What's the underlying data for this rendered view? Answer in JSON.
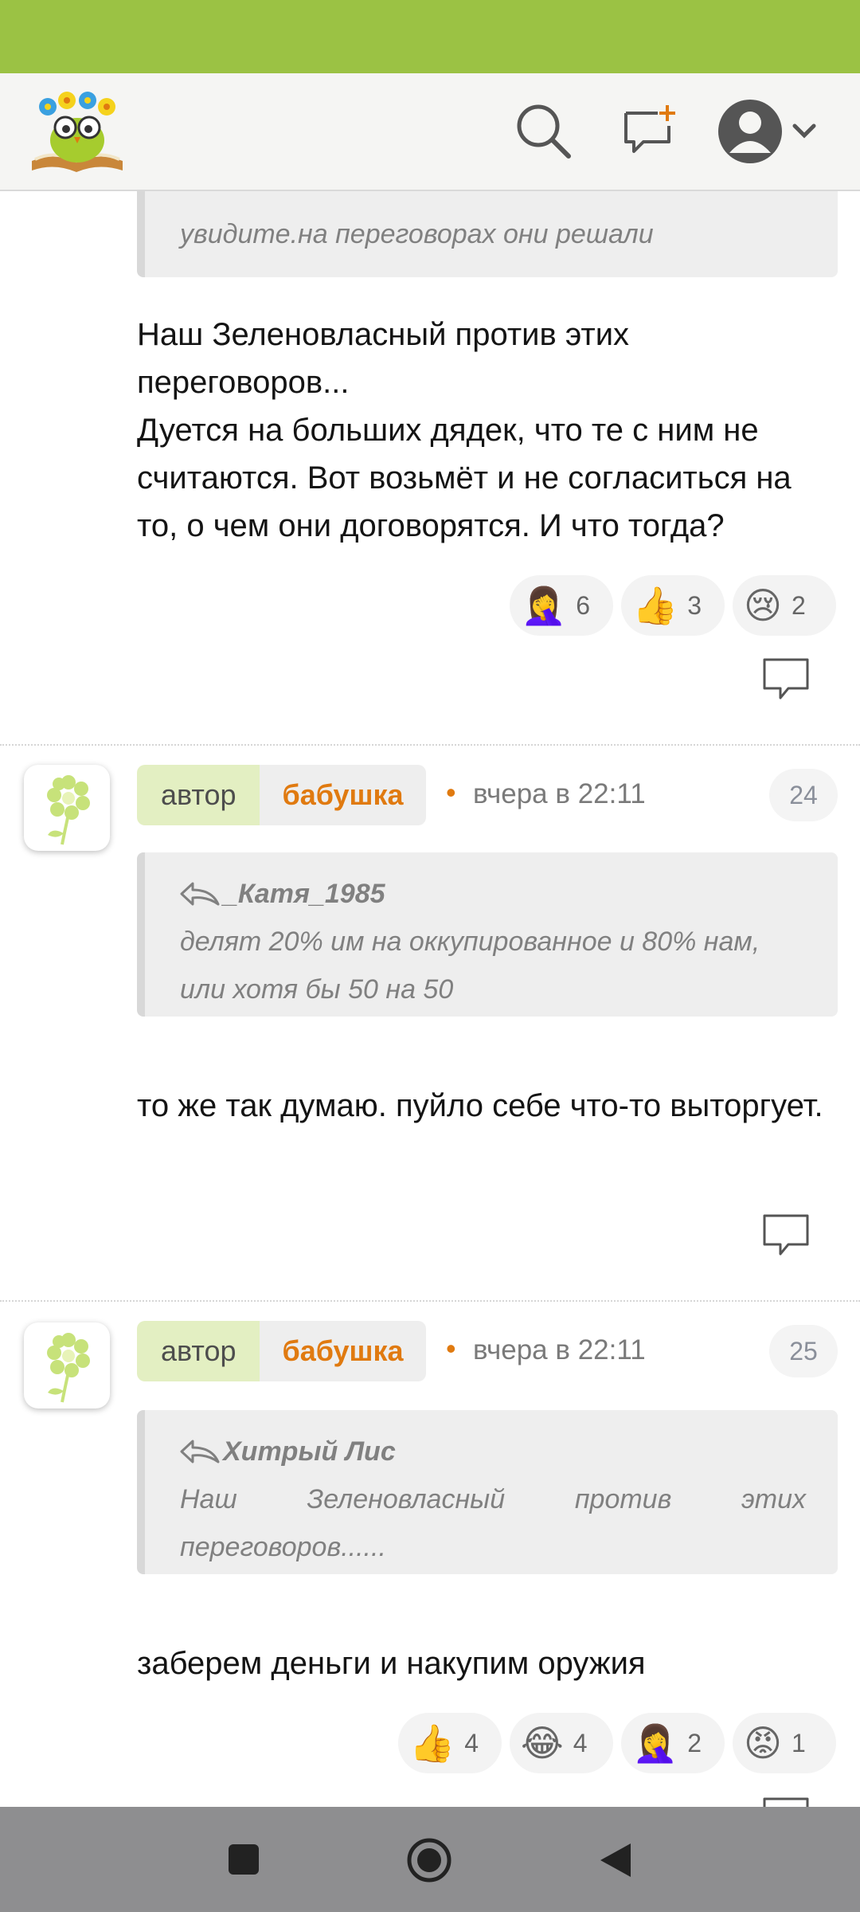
{
  "colors": {
    "status_bar": "#9bc244",
    "accent_orange": "#e07a10",
    "author_role_bg": "#e3efc2",
    "nav_bar": "#8e8e90"
  },
  "header": {
    "logo": "site-logo-flower-owl",
    "icons": [
      "search-icon",
      "new-message-icon",
      "user-avatar-icon",
      "chevron-down-icon"
    ]
  },
  "post1": {
    "quote_text": "увидите.на переговорах они решали",
    "text": "Наш Зеленовласный против этих переговоров...\nДуется на больших дядек, что те с ним не считаются. Вот возьмёт и не согласиться на то, о чем они договорятся. И что тогда?",
    "reactions": [
      {
        "emoji": "🤦‍♀️",
        "icon": "facepalm-emoji",
        "count": "6"
      },
      {
        "emoji": "👍",
        "icon": "thumbs-up-emoji",
        "count": "3"
      },
      {
        "emoji": "😢",
        "icon": "crying-face-emoji",
        "count": "2"
      }
    ]
  },
  "post2": {
    "role": "автор",
    "author": "бабушка",
    "bullet": "•",
    "time": "вчера в 22:11",
    "number": "24",
    "quote_author": "_Катя_1985",
    "quote_text": "делят 20% им на оккупированное и 80% нам, или хотя бы 50 на 50",
    "text": "то же так думаю. пуйло себе что-то выторгует."
  },
  "post3": {
    "role": "автор",
    "author": "бабушка",
    "bullet": "•",
    "time": "вчера в 22:11",
    "number": "25",
    "quote_author": "Хитрый Лис",
    "quote_text": "Наш Зеленовласный против этих переговоров......",
    "text": "заберем деньги и накупим оружия",
    "reactions": [
      {
        "emoji": "👍",
        "icon": "thumbs-up-emoji",
        "count": "4"
      },
      {
        "emoji": "😂",
        "icon": "laughing-tears-emoji",
        "count": "4"
      },
      {
        "emoji": "🤦‍♀️",
        "icon": "facepalm-emoji",
        "count": "2"
      },
      {
        "emoji": "😡",
        "icon": "angry-face-emoji",
        "count": "1"
      }
    ]
  },
  "nav": {
    "buttons": [
      "recents-button",
      "home-button",
      "back-button"
    ]
  }
}
